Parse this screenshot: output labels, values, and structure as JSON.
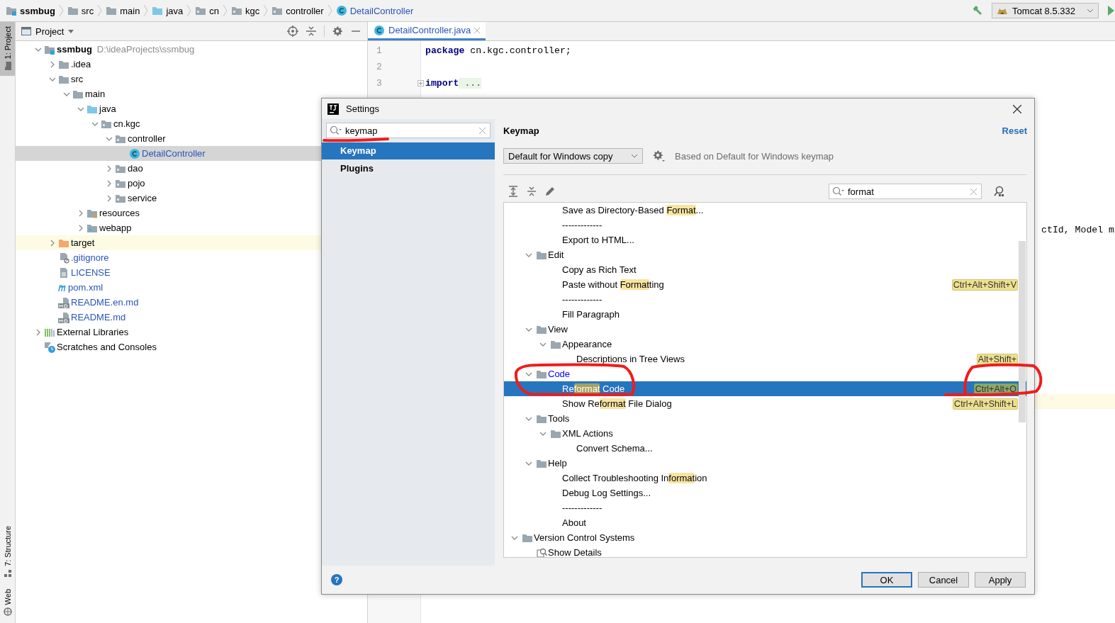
{
  "breadcrumbs": [
    {
      "label": "ssmbug",
      "kind": "module",
      "bold": true
    },
    {
      "label": "src",
      "kind": "folder",
      "bold": false
    },
    {
      "label": "main",
      "kind": "folder",
      "bold": false
    },
    {
      "label": "java",
      "kind": "source",
      "bold": false
    },
    {
      "label": "cn",
      "kind": "package",
      "bold": false
    },
    {
      "label": "kgc",
      "kind": "package",
      "bold": false
    },
    {
      "label": "controller",
      "kind": "package",
      "bold": false
    },
    {
      "label": "DetailController",
      "kind": "class",
      "bold": false
    }
  ],
  "run_config": {
    "label": "Tomcat 8.5.332"
  },
  "tool_stripe": {
    "top": [
      {
        "label": "1: Project",
        "selected": true
      }
    ],
    "bottom": [
      {
        "label": "7: Structure",
        "selected": false,
        "kind": "structure"
      },
      {
        "label": "Web",
        "selected": false,
        "kind": "web"
      }
    ]
  },
  "project_panel": {
    "title": "Project",
    "tree": [
      {
        "label": "ssmbug",
        "kind": "module",
        "bold": true,
        "path": "D:\\ideaProjects\\ssmbug",
        "expanded": true,
        "children": [
          {
            "label": ".idea",
            "kind": "folder",
            "expanded": false
          },
          {
            "label": "src",
            "kind": "folder",
            "expanded": true,
            "children": [
              {
                "label": "main",
                "kind": "folder",
                "expanded": true,
                "children": [
                  {
                    "label": "java",
                    "kind": "source",
                    "expanded": true,
                    "children": [
                      {
                        "label": "cn.kgc",
                        "kind": "package",
                        "expanded": true,
                        "children": [
                          {
                            "label": "controller",
                            "kind": "package",
                            "expanded": true,
                            "children": [
                              {
                                "label": "DetailController",
                                "kind": "class",
                                "added": true,
                                "selected": true
                              }
                            ]
                          },
                          {
                            "label": "dao",
                            "kind": "package",
                            "expanded": false
                          },
                          {
                            "label": "pojo",
                            "kind": "package",
                            "expanded": false
                          },
                          {
                            "label": "service",
                            "kind": "package",
                            "expanded": false
                          }
                        ]
                      }
                    ]
                  },
                  {
                    "label": "resources",
                    "kind": "resources",
                    "expanded": false
                  },
                  {
                    "label": "webapp",
                    "kind": "web",
                    "expanded": false
                  }
                ]
              }
            ]
          },
          {
            "label": "target",
            "kind": "excluded",
            "expanded": false,
            "excluded": true
          },
          {
            "label": ".gitignore",
            "kind": "ignore",
            "added": true
          },
          {
            "label": "LICENSE",
            "kind": "text",
            "added": true
          },
          {
            "label": "pom.xml",
            "kind": "maven",
            "added": true
          },
          {
            "label": "README.en.md",
            "kind": "markdown",
            "added": true
          },
          {
            "label": "README.md",
            "kind": "markdown",
            "added": true
          }
        ]
      },
      {
        "label": "External Libraries",
        "kind": "libraries",
        "expanded": false
      },
      {
        "label": "Scratches and Consoles",
        "kind": "scratches"
      }
    ]
  },
  "editor": {
    "tab": {
      "label": "DetailController.java",
      "selected": true
    },
    "lines": [
      {
        "number": "1",
        "code": [
          {
            "kind": "keyword",
            "text": "package"
          },
          {
            "kind": "plain",
            "text": " cn.kgc.controller;"
          }
        ]
      },
      {
        "number": "2"
      },
      {
        "number": "3",
        "folded": true,
        "code": [
          {
            "kind": "keyword",
            "text": "import"
          },
          {
            "kind": "fold",
            "text": " ..."
          }
        ]
      }
    ],
    "fragment": "ctId, Model m"
  },
  "dialog": {
    "title": "Settings",
    "search": {
      "value": "keymap"
    },
    "nav": [
      {
        "label": "Keymap",
        "selected": true
      },
      {
        "label": "Plugins",
        "selected": false
      }
    ],
    "heading": "Keymap",
    "reset": "Reset",
    "keymap": {
      "value": "Default for Windows copy"
    },
    "based_on": "Based on Default for Windows keymap",
    "filter": {
      "value": "format"
    },
    "tree": {
      "hidden_group_rest": [
        {
          "parts": [
            {
              "text": "Save as Directory-Based "
            },
            {
              "text": "Format",
              "match": true
            },
            {
              "text": "..."
            }
          ]
        },
        {
          "parts": [
            {
              "text": "-------------"
            }
          ]
        },
        {
          "parts": [
            {
              "text": "Export to HTML..."
            }
          ]
        }
      ],
      "hidden_menu_rest": [
        {
          "label": "Edit",
          "expanded": true,
          "children": [
            {
              "parts": [
                {
                  "text": "Copy as Rich Text"
                }
              ]
            },
            {
              "parts": [
                {
                  "text": "Paste without "
                },
                {
                  "text": "Format",
                  "match": true
                },
                {
                  "text": "ting"
                }
              ],
              "shortcut": "Ctrl+Alt+Shift+V"
            },
            {
              "parts": [
                {
                  "text": "-------------"
                }
              ]
            },
            {
              "parts": [
                {
                  "text": "Fill Paragraph"
                }
              ]
            }
          ]
        },
        {
          "label": "View",
          "expanded": true,
          "children": [
            {
              "label": "Appearance",
              "expanded": true,
              "children": [
                {
                  "parts": [
                    {
                      "text": "Descriptions in Tree Views"
                    }
                  ],
                  "shortcut": "Alt+Shift+"
                }
              ]
            }
          ]
        },
        {
          "label": "Code",
          "expanded": true,
          "modified": true,
          "children": [
            {
              "parts": [
                {
                  "text": "Re"
                },
                {
                  "text": "format",
                  "match": true
                },
                {
                  "text": " Code"
                }
              ],
              "shortcut": "Ctrl+Alt+Q",
              "selected": true
            },
            {
              "parts": [
                {
                  "text": "Show Re"
                },
                {
                  "text": "format",
                  "match": true
                },
                {
                  "text": " File Dialog"
                }
              ],
              "shortcut": "Ctrl+Alt+Shift+L",
              "selected": false
            }
          ]
        },
        {
          "label": "Tools",
          "expanded": true,
          "children": [
            {
              "label": "XML Actions",
              "expanded": true,
              "children": [
                {
                  "parts": [
                    {
                      "text": "Convert Schema..."
                    }
                  ]
                }
              ]
            }
          ]
        },
        {
          "label": "Help",
          "expanded": true,
          "children": [
            {
              "parts": [
                {
                  "text": "Collect Troubleshooting In"
                },
                {
                  "text": "format",
                  "match": true
                },
                {
                  "text": "ion"
                }
              ]
            },
            {
              "parts": [
                {
                  "text": "Debug Log Settings..."
                }
              ]
            },
            {
              "parts": [
                {
                  "text": "-------------"
                }
              ]
            },
            {
              "parts": [
                {
                  "text": "About"
                }
              ]
            }
          ]
        }
      ],
      "items": [
        {
          "label": "Version Control Systems",
          "expanded": true,
          "children": [
            {
              "parts": [
                {
                  "text": "Show Details"
                }
              ],
              "kind": "details"
            }
          ]
        }
      ]
    },
    "help": "?",
    "buttons": [
      {
        "label": "OK",
        "default": true
      },
      {
        "label": "Cancel",
        "default": false
      },
      {
        "label": "Apply",
        "default": false
      }
    ]
  }
}
